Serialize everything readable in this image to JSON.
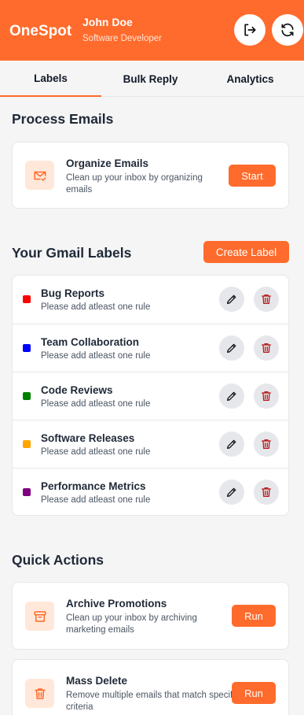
{
  "header": {
    "brand": "OneSpot",
    "user_name": "John Doe",
    "user_role": "Software Developer",
    "logout_icon": "logout-icon",
    "refresh_icon": "refresh-icon",
    "color": "#ff6b2c"
  },
  "tabs": [
    {
      "label": "Labels",
      "active": true
    },
    {
      "label": "Bulk Reply",
      "active": false
    },
    {
      "label": "Analytics",
      "active": false
    }
  ],
  "process": {
    "title": "Process Emails",
    "card": {
      "icon": "mail-check-icon",
      "title": "Organize Emails",
      "desc": "Clean up your inbox by organizing emails",
      "button": "Start"
    }
  },
  "labels_section": {
    "title": "Your Gmail Labels",
    "create_button": "Create Label",
    "items": [
      {
        "name": "Bug Reports",
        "sub": "Please add atleast one rule",
        "color": "#ff0000"
      },
      {
        "name": "Team Collaboration",
        "sub": "Please add atleast one rule",
        "color": "#0000ff"
      },
      {
        "name": "Code Reviews",
        "sub": "Please add atleast one rule",
        "color": "#008000"
      },
      {
        "name": "Software Releases",
        "sub": "Please add atleast one rule",
        "color": "#ffa500"
      },
      {
        "name": "Performance Metrics",
        "sub": "Please add atleast one rule",
        "color": "#800080"
      }
    ]
  },
  "quick_actions": {
    "title": "Quick Actions",
    "items": [
      {
        "icon": "archive-icon",
        "title": "Archive Promotions",
        "desc": "Clean up your inbox by archiving marketing emails",
        "button": "Run"
      },
      {
        "icon": "trash-icon",
        "title": "Mass Delete",
        "desc": "Remove multiple emails that match specific criteria",
        "button": "Run"
      }
    ]
  },
  "colors": {
    "accent": "#ff6b2c",
    "delete_icon": "#b91c1c"
  }
}
